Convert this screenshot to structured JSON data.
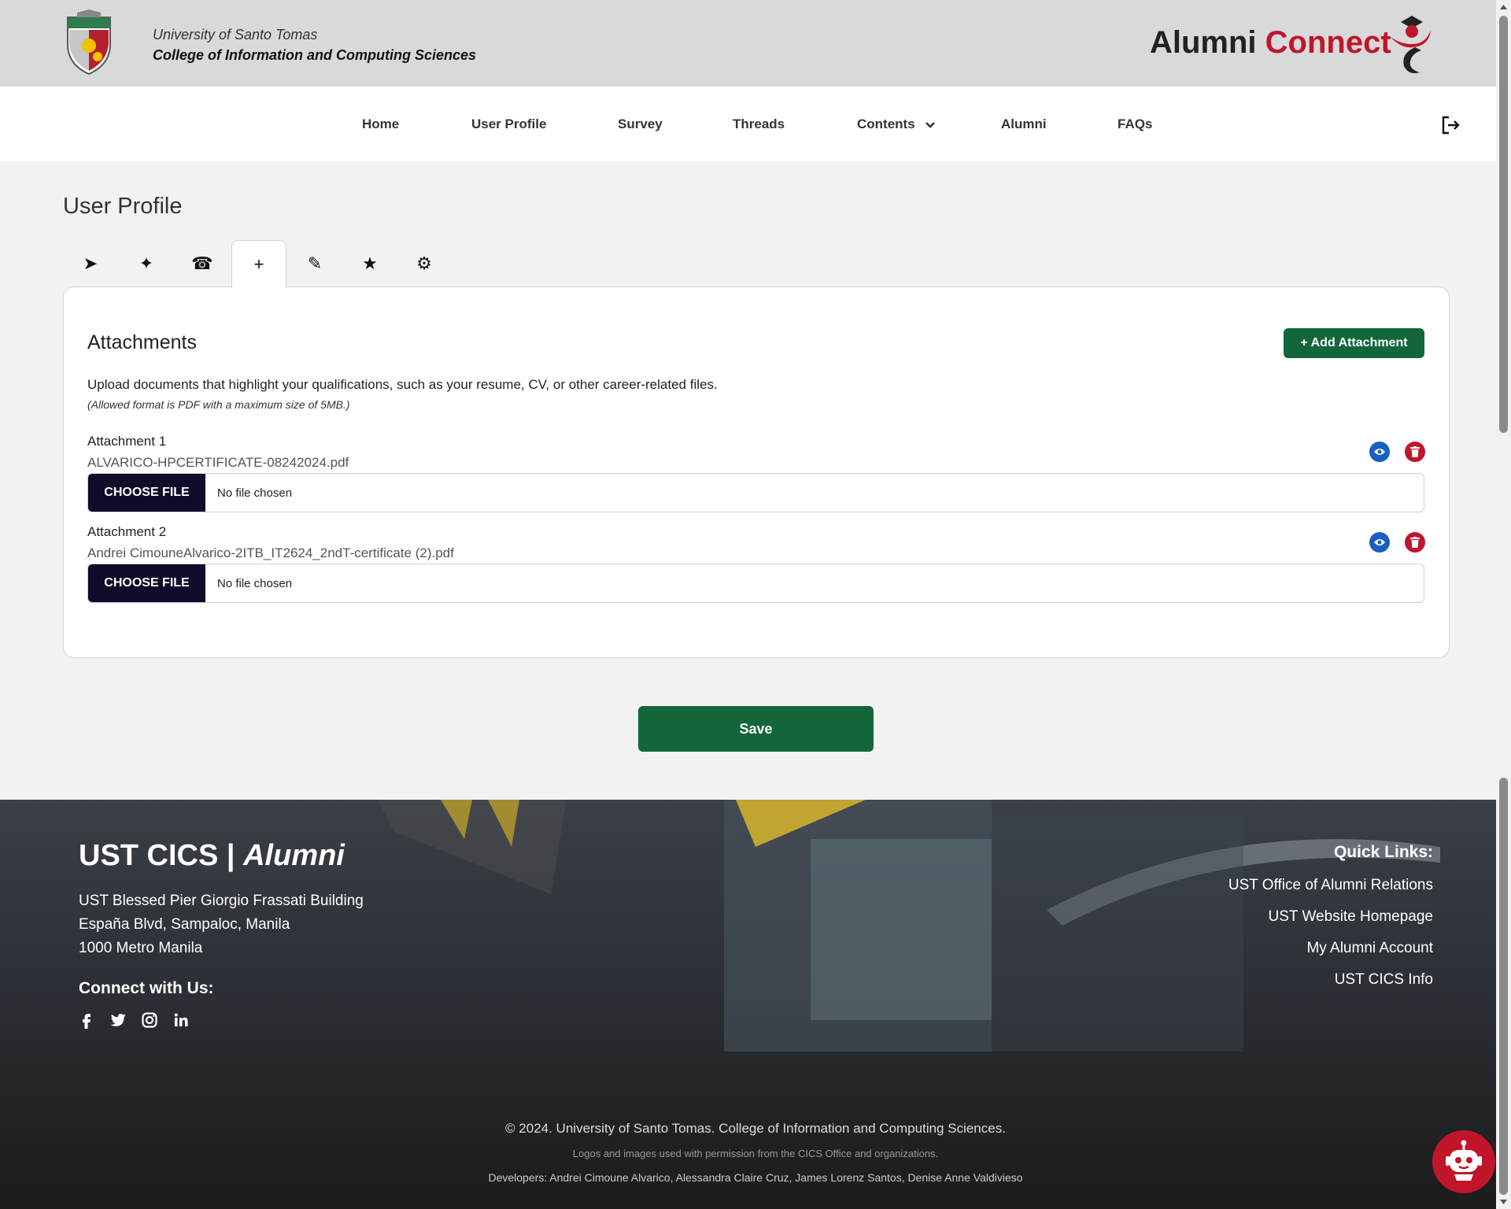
{
  "header": {
    "university": "University of Santo Tomas",
    "college": "College of Information and Computing Sciences",
    "brand_main": "Alumni",
    "brand_accent": "Connect"
  },
  "nav": {
    "items": [
      "Home",
      "User Profile",
      "Survey",
      "Threads",
      "Contents",
      "Alumni",
      "FAQs"
    ]
  },
  "page": {
    "title": "User Profile"
  },
  "tabs": [
    "➤",
    "✦",
    "☎",
    "+",
    "✎",
    "★",
    "⚙"
  ],
  "attachments": {
    "title": "Attachments",
    "add_button": "+ Add Attachment",
    "description": "Upload documents that highlight your qualifications, such as your resume, CV, or other career-related files.",
    "note": "(Allowed format is PDF with a maximum size of 5MB.)",
    "items": [
      {
        "label": "Attachment 1",
        "file": "ALVARICO-HPCERTIFICATE-08242024.pdf",
        "button": "CHOOSE FILE",
        "status": "No file chosen"
      },
      {
        "label": "Attachment 2",
        "file": "Andrei CimouneAlvarico-2ITB_IT2624_2ndT-certificate (2).pdf",
        "button": "CHOOSE FILE",
        "status": "No file chosen"
      }
    ]
  },
  "save_button": "Save",
  "footer": {
    "title_main": "UST CICS |",
    "title_italic": "Alumni",
    "address": [
      "UST Blessed Pier Giorgio Frassati Building",
      "España Blvd, Sampaloc, Manila",
      "1000 Metro Manila"
    ],
    "connect": "Connect with Us:",
    "social_icons": [
      "facebook-icon",
      "twitter-icon",
      "instagram-icon",
      "linkedin-icon"
    ],
    "quick_links_title": "Quick Links:",
    "quick_links": [
      "UST Office of Alumni Relations",
      "UST Website Homepage",
      "My Alumni Account",
      "UST CICS Info"
    ],
    "copyright": "© 2024. University of Santo Tomas. College of Information and Computing Sciences.",
    "permission": "Logos and images used with permission from the CICS Office and organizations.",
    "developers": "Developers: Andrei Cimoune Alvarico, Alessandra Claire Cruz, James Lorenz Santos, Denise Anne Valdivieso"
  },
  "colors": {
    "accent_green": "#11673a",
    "brand_red": "#c0152a",
    "dark_navy": "#0e0c2a",
    "view_blue": "#1a5fc1"
  }
}
